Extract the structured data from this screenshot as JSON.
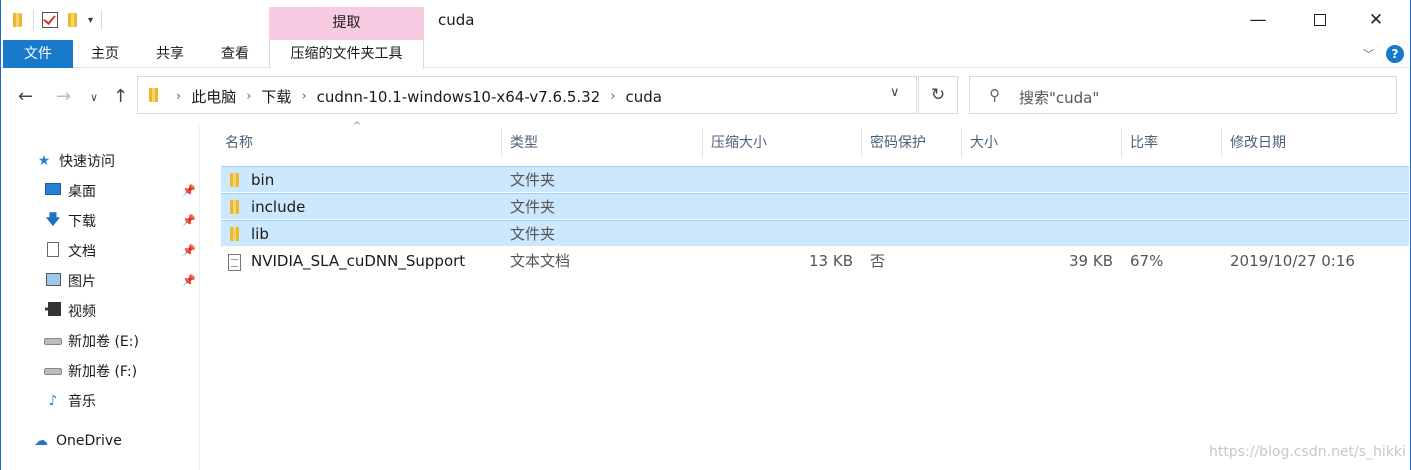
{
  "window": {
    "title": "cuda",
    "contextual_tab_header": "提取",
    "minimize_glyph": "—",
    "close_glyph": "✕"
  },
  "ribbon": {
    "tabs": [
      "文件",
      "主页",
      "共享",
      "查看",
      "压缩的文件夹工具"
    ],
    "expand_glyph": "﹀",
    "help_glyph": "?"
  },
  "nav": {
    "back_glyph": "←",
    "forward_glyph": "→",
    "recent_glyph": "∨",
    "up_glyph": "↑",
    "breadcrumbs": [
      "此电脑",
      "下载",
      "cudnn-10.1-windows10-x64-v7.6.5.32",
      "cuda"
    ],
    "chevron": "›",
    "dropdown_glyph": "∨",
    "refresh_glyph": "↻",
    "search_placeholder": "搜索\"cuda\""
  },
  "sidebar": {
    "quick_access": "快速访问",
    "items": [
      {
        "label": "桌面",
        "icon": "desktop-icon",
        "pinned": true
      },
      {
        "label": "下载",
        "icon": "download-icon",
        "pinned": true
      },
      {
        "label": "文档",
        "icon": "document-icon",
        "pinned": true
      },
      {
        "label": "图片",
        "icon": "pictures-icon",
        "pinned": true
      },
      {
        "label": "视频",
        "icon": "video-icon",
        "pinned": false
      },
      {
        "label": "新加卷 (E:)",
        "icon": "drive-icon",
        "pinned": false
      },
      {
        "label": "新加卷 (F:)",
        "icon": "drive-icon",
        "pinned": false
      },
      {
        "label": "音乐",
        "icon": "music-icon",
        "pinned": false
      }
    ],
    "onedrive": "OneDrive",
    "pin_glyph": "📌"
  },
  "columns": [
    "名称",
    "类型",
    "压缩大小",
    "密码保护",
    "大小",
    "比率",
    "修改日期"
  ],
  "sort_glyph": "^",
  "files": [
    {
      "name": "bin",
      "type": "文件夹",
      "csize": "",
      "pwd": "",
      "size": "",
      "ratio": "",
      "date": "",
      "kind": "folder",
      "selected": true
    },
    {
      "name": "include",
      "type": "文件夹",
      "csize": "",
      "pwd": "",
      "size": "",
      "ratio": "",
      "date": "",
      "kind": "folder",
      "selected": true
    },
    {
      "name": "lib",
      "type": "文件夹",
      "csize": "",
      "pwd": "",
      "size": "",
      "ratio": "",
      "date": "",
      "kind": "folder",
      "selected": true
    },
    {
      "name": "NVIDIA_SLA_cuDNN_Support",
      "type": "文本文档",
      "csize": "13 KB",
      "pwd": "否",
      "size": "39 KB",
      "ratio": "67%",
      "date": "2019/10/27 0:16",
      "kind": "text",
      "selected": false
    }
  ],
  "watermark": "https://blog.csdn.net/s_hikki",
  "colors": {
    "accent": "#1979ca",
    "selection": "#cce8ff",
    "contextual_tab": "#f9cbe2"
  }
}
